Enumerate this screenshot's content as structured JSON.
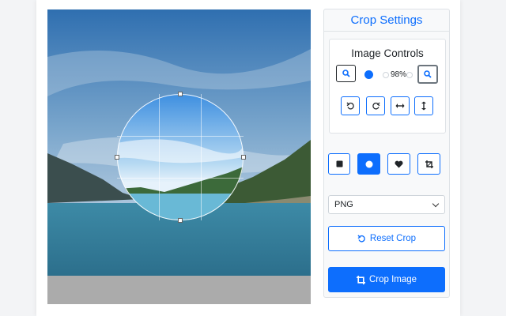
{
  "panel": {
    "title": "Crop Settings",
    "controls_title": "Image Controls",
    "zoom": {
      "value": 98,
      "value_label": "98%"
    },
    "zoom_out_icon": "zoom-out-icon",
    "zoom_in_icon": "zoom-in-icon",
    "transform_icons": [
      "rotate-left-icon",
      "rotate-right-icon",
      "flip-horizontal-icon",
      "flip-vertical-icon"
    ],
    "shape_icons": [
      "square-icon",
      "circle-icon",
      "heart-icon",
      "custom-crop-icon"
    ],
    "selected_shape": "circle",
    "format": {
      "selected": "PNG"
    },
    "reset_label": "Reset Crop",
    "crop_label": "Crop Image"
  },
  "colors": {
    "accent": "#0d6efd",
    "panel_bg": "#f8f9fa",
    "border": "#dee2e6",
    "canvas_bg": "#ababab"
  }
}
